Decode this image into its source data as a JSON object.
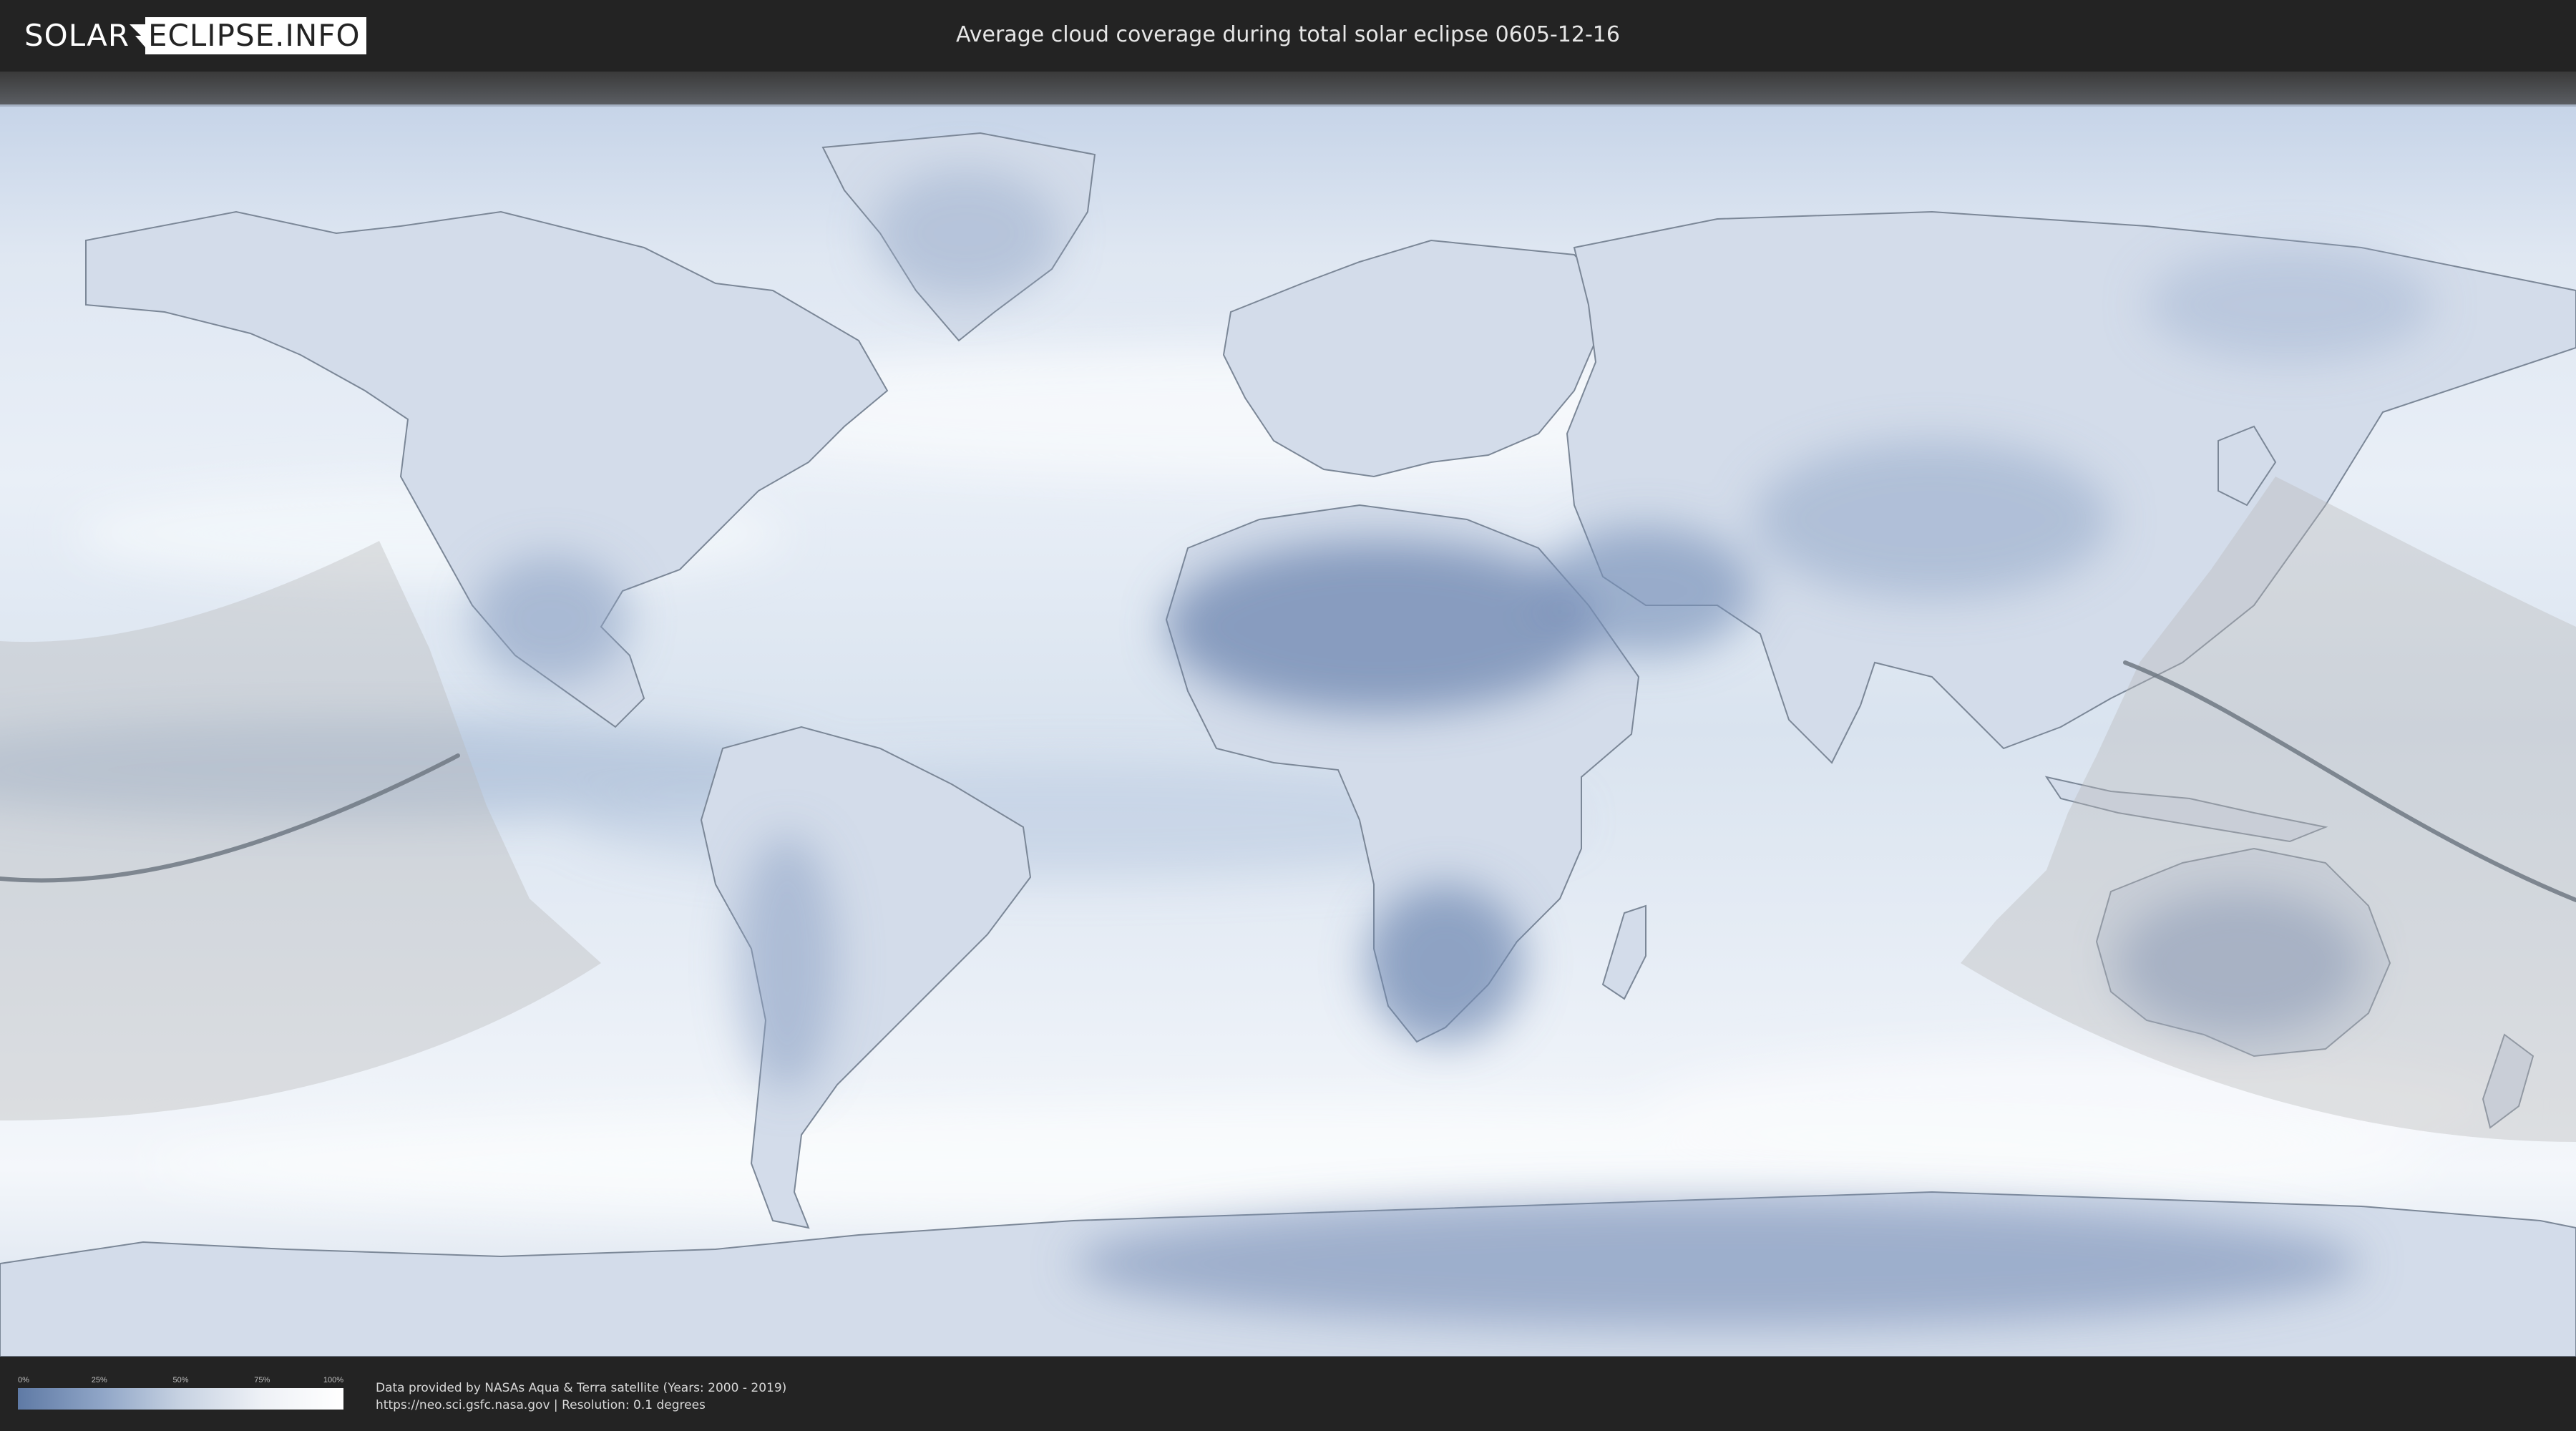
{
  "header": {
    "logo": {
      "part1": "SOLAR",
      "part2": "ECLIPSE.INFO"
    },
    "title": "Average cloud coverage during total solar eclipse 0605-12-16"
  },
  "map": {
    "icon": "world-cloud-map",
    "colors": {
      "clear_sky": "#5f7aa5",
      "overcast": "#ffffff",
      "penumbra_shade": "#c9c9c9",
      "path_line": "#6f7882",
      "land_outline": "#7b8797"
    }
  },
  "legend": {
    "ticks": [
      "0%",
      "25%",
      "50%",
      "75%",
      "100%"
    ],
    "tick_fractions": [
      0,
      0.25,
      0.5,
      0.75,
      1
    ]
  },
  "footer": {
    "source_line1": "Data provided by NASAs Aqua & Terra satellite (Years: 2000 - 2019)",
    "source_url": "https://neo.sci.gsfc.nasa.gov",
    "source_sep": " | ",
    "resolution": "Resolution: 0.1 degrees"
  }
}
